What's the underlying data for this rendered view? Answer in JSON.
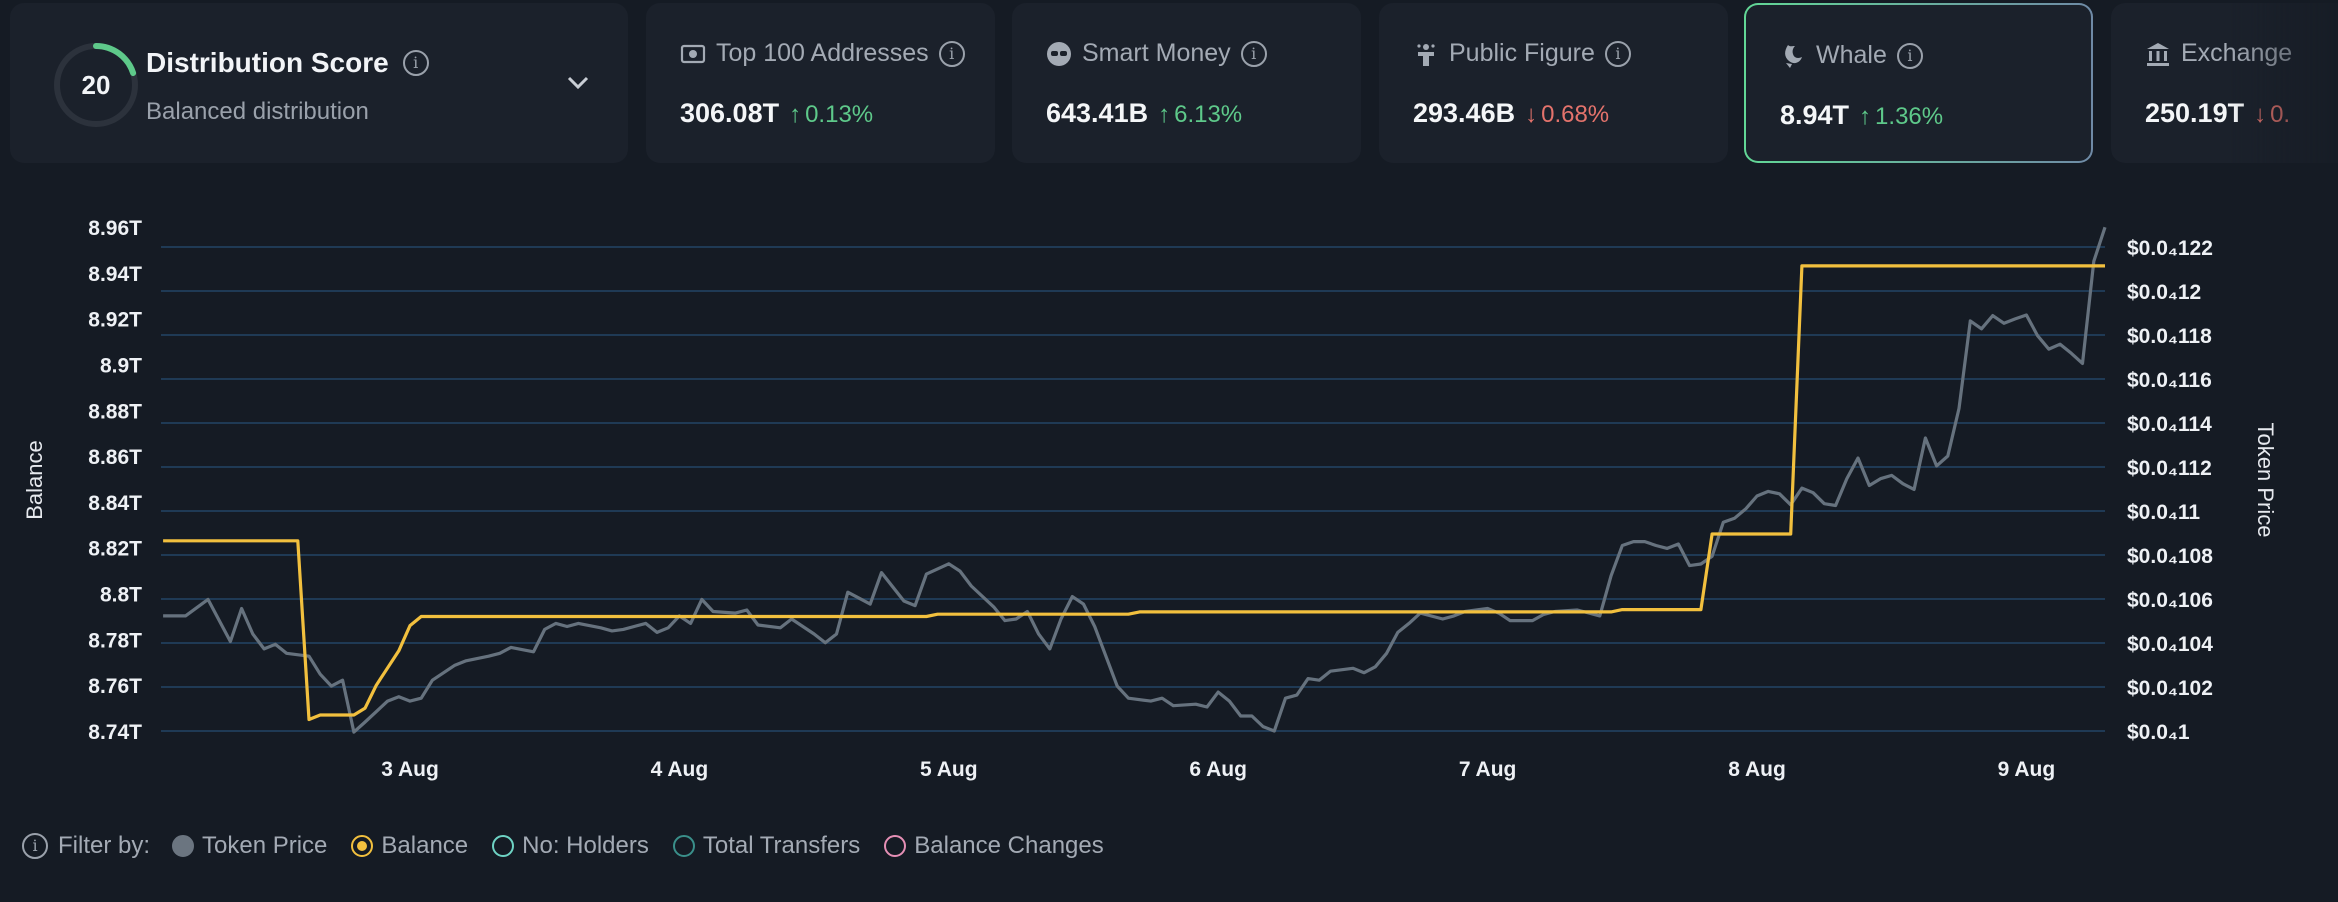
{
  "score_card": {
    "score": "20",
    "score_fraction": 0.2,
    "title": "Distribution Score",
    "subtitle": "Balanced distribution",
    "ring_color": "#5ec98a"
  },
  "metrics": [
    {
      "icon": "money-icon",
      "label": "Top 100 Addresses",
      "value": "306.08T",
      "change": "0.13%",
      "direction": "up"
    },
    {
      "icon": "sunglasses-icon",
      "label": "Smart Money",
      "value": "643.41B",
      "change": "6.13%",
      "direction": "up"
    },
    {
      "icon": "podium-icon",
      "label": "Public Figure",
      "value": "293.46B",
      "change": "0.68%",
      "direction": "down"
    },
    {
      "icon": "whale-icon",
      "label": "Whale",
      "value": "8.94T",
      "change": "1.36%",
      "direction": "up",
      "selected": true
    },
    {
      "icon": "bank-icon",
      "label": "Exchange",
      "value": "250.19T",
      "change": "0.",
      "direction": "down"
    }
  ],
  "arrows": {
    "up": "↑",
    "down": "↓"
  },
  "colors": {
    "up": "#5ec98a",
    "down": "#e4736c",
    "price": "#66727e",
    "balance": "#f2c03e",
    "grid": "#1f3a55"
  },
  "legend": {
    "label": "Filter by:",
    "items": [
      {
        "label": "Token Price",
        "color": "#6b7580",
        "style": "filled",
        "active": true
      },
      {
        "label": "Balance",
        "color": "#f2c03e",
        "style": "ring-dot",
        "active": true
      },
      {
        "label": "No: Holders",
        "color": "#6ed3c4",
        "style": "ring",
        "active": false
      },
      {
        "label": "Total Transfers",
        "color": "#3a8f8a",
        "style": "ring",
        "active": false
      },
      {
        "label": "Balance Changes",
        "color": "#e58fb5",
        "style": "ring",
        "active": false
      }
    ]
  },
  "chart_data": {
    "type": "line",
    "ylabel": "Balance",
    "y2label": "Token Price",
    "grid": true,
    "x_ticks": [
      "3 Aug",
      "4 Aug",
      "5 Aug",
      "6 Aug",
      "7 Aug",
      "8 Aug",
      "9 Aug"
    ],
    "y_ticks": [
      {
        "label": "8.96T",
        "value": 8.96
      },
      {
        "label": "8.94T",
        "value": 8.94
      },
      {
        "label": "8.92T",
        "value": 8.92
      },
      {
        "label": "8.9T",
        "value": 8.9
      },
      {
        "label": "8.88T",
        "value": 8.88
      },
      {
        "label": "8.86T",
        "value": 8.86
      },
      {
        "label": "8.84T",
        "value": 8.84
      },
      {
        "label": "8.82T",
        "value": 8.82
      },
      {
        "label": "8.8T",
        "value": 8.8
      },
      {
        "label": "8.78T",
        "value": 8.78
      },
      {
        "label": "8.76T",
        "value": 8.76
      },
      {
        "label": "8.74T",
        "value": 8.74
      }
    ],
    "y2_ticks": [
      {
        "label": "$0.0₄122",
        "value": 1.22e-05
      },
      {
        "label": "$0.0₄12",
        "value": 1.2e-05
      },
      {
        "label": "$0.0₄118",
        "value": 1.18e-05
      },
      {
        "label": "$0.0₄116",
        "value": 1.16e-05
      },
      {
        "label": "$0.0₄114",
        "value": 1.14e-05
      },
      {
        "label": "$0.0₄112",
        "value": 1.12e-05
      },
      {
        "label": "$0.0₄11",
        "value": 1.1e-05
      },
      {
        "label": "$0.0₄108",
        "value": 1.08e-05
      },
      {
        "label": "$0.0₄106",
        "value": 1.06e-05
      },
      {
        "label": "$0.0₄104",
        "value": 1.04e-05
      },
      {
        "label": "$0.0₄102",
        "value": 1.02e-05
      },
      {
        "label": "$0.0₄1",
        "value": 1e-05
      }
    ],
    "series": [
      {
        "name": "Token Price",
        "axis": "right",
        "points": [
          [
            "2 Aug 02:00",
            1.0523e-05
          ],
          [
            "2 Aug 04:00",
            1.0523e-05
          ],
          [
            "2 Aug 06:00",
            1.0598e-05
          ],
          [
            "2 Aug 08:00",
            1.0407e-05
          ],
          [
            "2 Aug 09:00",
            1.0557e-05
          ],
          [
            "2 Aug 10:00",
            1.0441e-05
          ],
          [
            "2 Aug 11:00",
            1.0373e-05
          ],
          [
            "2 Aug 12:00",
            1.0394e-05
          ],
          [
            "2 Aug 13:00",
            1.0353e-05
          ],
          [
            "2 Aug 15:00",
            1.034e-05
          ],
          [
            "2 Aug 16:00",
            1.0258e-05
          ],
          [
            "2 Aug 17:00",
            1.0204e-05
          ],
          [
            "2 Aug 18:00",
            1.0231e-05
          ],
          [
            "2 Aug 19:00",
            9.995e-06
          ],
          [
            "2 Aug 20:00",
            1.0041e-05
          ],
          [
            "2 Aug 22:00",
            1.0136e-05
          ],
          [
            "2 Aug 23:00",
            1.0156e-05
          ],
          [
            "3 Aug 00:00",
            1.0136e-05
          ],
          [
            "3 Aug 01:00",
            1.0149e-05
          ],
          [
            "3 Aug 02:00",
            1.0231e-05
          ],
          [
            "3 Aug 04:00",
            1.0299e-05
          ],
          [
            "3 Aug 05:00",
            1.0319e-05
          ],
          [
            "3 Aug 07:00",
            1.034e-05
          ],
          [
            "3 Aug 08:00",
            1.0353e-05
          ],
          [
            "3 Aug 09:00",
            1.038e-05
          ],
          [
            "3 Aug 11:00",
            1.036e-05
          ],
          [
            "3 Aug 12:00",
            1.0462e-05
          ],
          [
            "3 Aug 13:00",
            1.0489e-05
          ],
          [
            "3 Aug 14:00",
            1.0475e-05
          ],
          [
            "3 Aug 15:00",
            1.0489e-05
          ],
          [
            "3 Aug 17:00",
            1.0469e-05
          ],
          [
            "3 Aug 18:00",
            1.0455e-05
          ],
          [
            "3 Aug 19:00",
            1.0462e-05
          ],
          [
            "3 Aug 21:00",
            1.0489e-05
          ],
          [
            "3 Aug 22:00",
            1.0448e-05
          ],
          [
            "3 Aug 23:00",
            1.0469e-05
          ],
          [
            "4 Aug 00:00",
            1.0523e-05
          ],
          [
            "4 Aug 01:00",
            1.0489e-05
          ],
          [
            "4 Aug 02:00",
            1.0598e-05
          ],
          [
            "4 Aug 03:00",
            1.0543e-05
          ],
          [
            "4 Aug 05:00",
            1.0536e-05
          ],
          [
            "4 Aug 06:00",
            1.055e-05
          ],
          [
            "4 Aug 07:00",
            1.0482e-05
          ],
          [
            "4 Aug 09:00",
            1.0469e-05
          ],
          [
            "4 Aug 10:00",
            1.0509e-05
          ],
          [
            "4 Aug 12:00",
            1.0441e-05
          ],
          [
            "4 Aug 13:00",
            1.0401e-05
          ],
          [
            "4 Aug 14:00",
            1.0441e-05
          ],
          [
            "4 Aug 15:00",
            1.0631e-05
          ],
          [
            "4 Aug 17:00",
            1.0577e-05
          ],
          [
            "4 Aug 18:00",
            1.072e-05
          ],
          [
            "4 Aug 20:00",
            1.0591e-05
          ],
          [
            "4 Aug 21:00",
            1.057e-05
          ],
          [
            "4 Aug 22:00",
            1.0713e-05
          ],
          [
            "5 Aug 00:00",
            1.076e-05
          ],
          [
            "5 Aug 01:00",
            1.0727e-05
          ],
          [
            "5 Aug 02:00",
            1.0659e-05
          ],
          [
            "5 Aug 04:00",
            1.0564e-05
          ],
          [
            "5 Aug 05:00",
            1.0502e-05
          ],
          [
            "5 Aug 06:00",
            1.0509e-05
          ],
          [
            "5 Aug 07:00",
            1.0543e-05
          ],
          [
            "5 Aug 08:00",
            1.0441e-05
          ],
          [
            "5 Aug 09:00",
            1.0373e-05
          ],
          [
            "5 Aug 10:00",
            1.0509e-05
          ],
          [
            "5 Aug 11:00",
            1.0611e-05
          ],
          [
            "5 Aug 12:00",
            1.0577e-05
          ],
          [
            "5 Aug 13:00",
            1.0475e-05
          ],
          [
            "5 Aug 15:00",
            1.0204e-05
          ],
          [
            "5 Aug 16:00",
            1.0149e-05
          ],
          [
            "5 Aug 18:00",
            1.0136e-05
          ],
          [
            "5 Aug 19:00",
            1.0149e-05
          ],
          [
            "5 Aug 20:00",
            1.0115e-05
          ],
          [
            "5 Aug 22:00",
            1.0122e-05
          ],
          [
            "5 Aug 23:00",
            1.0109e-05
          ],
          [
            "6 Aug 00:00",
            1.0177e-05
          ],
          [
            "6 Aug 01:00",
            1.0136e-05
          ],
          [
            "6 Aug 02:00",
            1.0068e-05
          ],
          [
            "6 Aug 03:00",
            1.0068e-05
          ],
          [
            "6 Aug 04:00",
            1.002e-05
          ],
          [
            "6 Aug 05:00",
            1e-05
          ],
          [
            "6 Aug 06:00",
            1.0149e-05
          ],
          [
            "6 Aug 07:00",
            1.0163e-05
          ],
          [
            "6 Aug 08:00",
            1.0238e-05
          ],
          [
            "6 Aug 09:00",
            1.0231e-05
          ],
          [
            "6 Aug 10:00",
            1.0272e-05
          ],
          [
            "6 Aug 12:00",
            1.0285e-05
          ],
          [
            "6 Aug 13:00",
            1.0265e-05
          ],
          [
            "6 Aug 14:00",
            1.0292e-05
          ],
          [
            "6 Aug 15:00",
            1.0353e-05
          ],
          [
            "6 Aug 16:00",
            1.0448e-05
          ],
          [
            "6 Aug 17:00",
            1.0489e-05
          ],
          [
            "6 Aug 18:00",
            1.0536e-05
          ],
          [
            "6 Aug 20:00",
            1.0509e-05
          ],
          [
            "6 Aug 21:00",
            1.0523e-05
          ],
          [
            "6 Aug 22:00",
            1.0543e-05
          ],
          [
            "7 Aug 00:00",
            1.0557e-05
          ],
          [
            "7 Aug 01:00",
            1.0536e-05
          ],
          [
            "7 Aug 02:00",
            1.0502e-05
          ],
          [
            "7 Aug 04:00",
            1.0502e-05
          ],
          [
            "7 Aug 05:00",
            1.053e-05
          ],
          [
            "7 Aug 06:00",
            1.0543e-05
          ],
          [
            "7 Aug 08:00",
            1.055e-05
          ],
          [
            "7 Aug 10:00",
            1.0523e-05
          ],
          [
            "7 Aug 11:00",
            1.0706e-05
          ],
          [
            "7 Aug 12:00",
            1.0843e-05
          ],
          [
            "7 Aug 13:00",
            1.0861e-05
          ],
          [
            "7 Aug 14:00",
            1.0861e-05
          ],
          [
            "7 Aug 15:00",
            1.0843e-05
          ],
          [
            "7 Aug 16:00",
            1.083e-05
          ],
          [
            "7 Aug 17:00",
            1.085e-05
          ],
          [
            "7 Aug 18:00",
            1.0752e-05
          ],
          [
            "7 Aug 19:00",
            1.0759e-05
          ],
          [
            "7 Aug 20:00",
            1.0794e-05
          ],
          [
            "7 Aug 21:00",
            1.0949e-05
          ],
          [
            "7 Aug 22:00",
            1.0967e-05
          ],
          [
            "7 Aug 23:00",
            1.101e-05
          ],
          [
            "8 Aug 00:00",
            1.1068e-05
          ],
          [
            "8 Aug 01:00",
            1.1089e-05
          ],
          [
            "8 Aug 02:00",
            1.1078e-05
          ],
          [
            "8 Aug 03:00",
            1.1028e-05
          ],
          [
            "8 Aug 04:00",
            1.1104e-05
          ],
          [
            "8 Aug 05:00",
            1.1083e-05
          ],
          [
            "8 Aug 06:00",
            1.1033e-05
          ],
          [
            "8 Aug 07:00",
            1.1025e-05
          ],
          [
            "8 Aug 08:00",
            1.1147e-05
          ],
          [
            "8 Aug 09:00",
            1.1241e-05
          ],
          [
            "8 Aug 10:00",
            1.1116e-05
          ],
          [
            "8 Aug 11:00",
            1.1147e-05
          ],
          [
            "8 Aug 12:00",
            1.1162e-05
          ],
          [
            "8 Aug 13:00",
            1.1124e-05
          ],
          [
            "8 Aug 14:00",
            1.1098e-05
          ],
          [
            "8 Aug 15:00",
            1.1332e-05
          ],
          [
            "8 Aug 16:00",
            1.1205e-05
          ],
          [
            "8 Aug 17:00",
            1.125e-05
          ],
          [
            "8 Aug 18:00",
            1.1466e-05
          ],
          [
            "8 Aug 19:00",
            1.1864e-05
          ],
          [
            "8 Aug 20:00",
            1.1828e-05
          ],
          [
            "8 Aug 21:00",
            1.1888e-05
          ],
          [
            "8 Aug 22:00",
            1.1853e-05
          ],
          [
            "8 Aug 23:00",
            1.1873e-05
          ],
          [
            "9 Aug 00:00",
            1.1891e-05
          ],
          [
            "9 Aug 01:00",
            1.1797e-05
          ],
          [
            "9 Aug 02:00",
            1.1736e-05
          ],
          [
            "9 Aug 03:00",
            1.1758e-05
          ],
          [
            "9 Aug 04:00",
            1.1717e-05
          ],
          [
            "9 Aug 05:00",
            1.1671e-05
          ],
          [
            "9 Aug 06:00",
            1.2135e-05
          ],
          [
            "9 Aug 07:00",
            1.229e-05
          ]
        ]
      },
      {
        "name": "Balance",
        "axis": "left",
        "points": [
          [
            "2 Aug 02:00",
            8.823
          ],
          [
            "2 Aug 14:00",
            8.823
          ],
          [
            "2 Aug 15:00",
            8.745
          ],
          [
            "2 Aug 16:00",
            8.747
          ],
          [
            "2 Aug 19:00",
            8.747
          ],
          [
            "2 Aug 20:00",
            8.75
          ],
          [
            "2 Aug 21:00",
            8.76
          ],
          [
            "2 Aug 23:00",
            8.775
          ],
          [
            "3 Aug 00:00",
            8.786
          ],
          [
            "3 Aug 01:00",
            8.79
          ],
          [
            "4 Aug 22:00",
            8.79
          ],
          [
            "4 Aug 23:00",
            8.791
          ],
          [
            "5 Aug 16:00",
            8.791
          ],
          [
            "5 Aug 17:00",
            8.792
          ],
          [
            "7 Aug 11:00",
            8.792
          ],
          [
            "7 Aug 12:00",
            8.793
          ],
          [
            "7 Aug 19:00",
            8.793
          ],
          [
            "7 Aug 20:00",
            8.826
          ],
          [
            "8 Aug 03:00",
            8.826
          ],
          [
            "8 Aug 04:00",
            8.943
          ],
          [
            "9 Aug 07:00",
            8.943
          ]
        ]
      }
    ]
  }
}
